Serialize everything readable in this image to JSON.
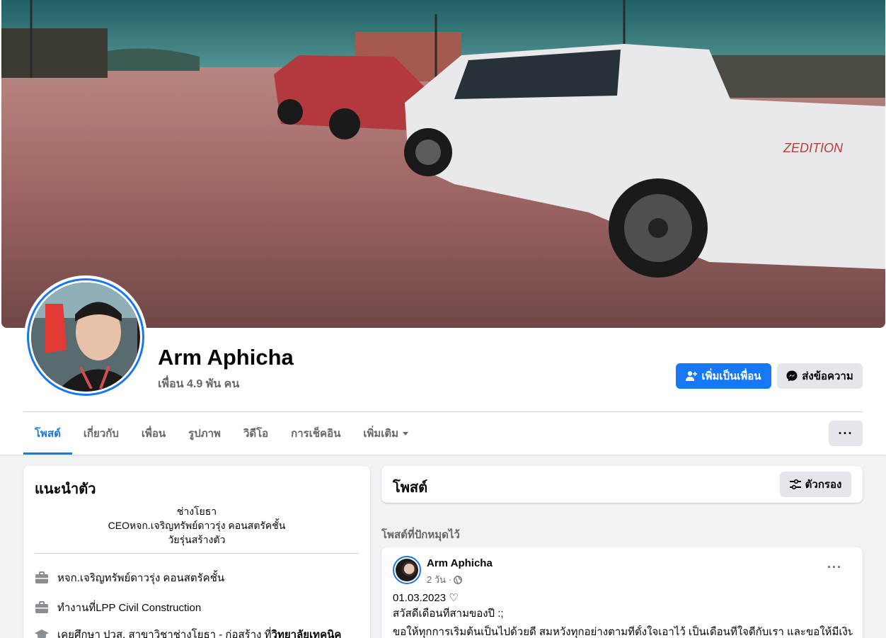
{
  "profile": {
    "name": "Arm Aphicha",
    "friends": "เพื่อน 4.9 พัน คน",
    "add_friend_label": "เพิ่มเป็นเพื่อน",
    "message_label": "ส่งข้อความ"
  },
  "tabs": [
    {
      "label": "โพสต์",
      "active": true
    },
    {
      "label": "เกี่ยวกับ"
    },
    {
      "label": "เพื่อน"
    },
    {
      "label": "รูปภาพ"
    },
    {
      "label": "วิดีโอ"
    },
    {
      "label": "การเช็คอิน"
    },
    {
      "label": "เพิ่มเติม"
    }
  ],
  "more_label": "···",
  "intro": {
    "title": "แนะนำตัว",
    "bio": [
      "ช่างโยธา",
      "CEOหจก.เจริญทรัพย์ดาวรุ่ง คอนสตรัคชั้น",
      "วัยรุ่นสร้างตัว"
    ],
    "work1": "หจก.เจริญทรัพย์ดาวรุ่ง คอนสตรัคชั้น",
    "work2_prefix": "ทำงานที่ ",
    "work2_place": "LPP Civil Construction",
    "edu_prefix": "เคยศึกษา ปวส. สาขาวิชาช่างโยธา - ก่อสร้าง ที่ ",
    "edu_place": "วิทยาลัยเทคนิค"
  },
  "posts_section": {
    "title": "โพสต์",
    "filter_label": "ตัวกรอง",
    "pinned_label": "โพสต์ที่ปักหมุดไว้"
  },
  "post": {
    "author": "Arm Aphicha",
    "time": "2 วัน ·",
    "line1": "01.03.2023 ♡",
    "line2": "สวัสดีเดือนที่สามของปี :;",
    "line3": "ขอให้ทุกการเริ่มต้นเป็นไปด้วยดี สมหวังทุกอย่างตามที่ตั้งใจเอาไว้ เป็นเดือนที่ใจดีกับเรา และขอให้มีเงินใช้"
  },
  "colors": {
    "accent": "#1877f2",
    "secondary_bg": "#e4e6eb",
    "muted_text": "#65676b"
  }
}
